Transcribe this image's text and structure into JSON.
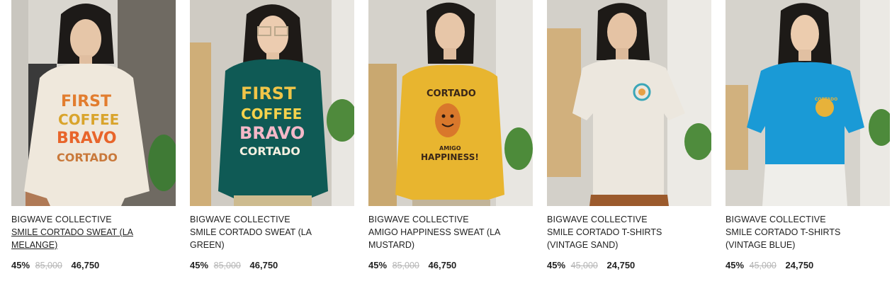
{
  "products": [
    {
      "brand": "BIGWAVE COLLECTIVE",
      "name": "SMILE CORTADO SWEAT (LA MELANGE)",
      "discount": "45%",
      "original_price": "85,000",
      "sale_price": "46,750",
      "garment_color": "#efe8dc",
      "garment_type": "sweat",
      "print_lines": [
        "FIRST",
        "COFFEE",
        "BRAVO",
        "CORTADO"
      ]
    },
    {
      "brand": "BIGWAVE COLLECTIVE",
      "name": "SMILE CORTADO SWEAT (LA GREEN)",
      "discount": "45%",
      "original_price": "85,000",
      "sale_price": "46,750",
      "garment_color": "#0f5a55",
      "garment_type": "sweat",
      "print_lines": [
        "FIRST",
        "COFFEE",
        "BRAVO",
        "CORTADO"
      ]
    },
    {
      "brand": "BIGWAVE COLLECTIVE",
      "name": "AMIGO HAPPINESS SWEAT (LA MUSTARD)",
      "discount": "45%",
      "original_price": "85,000",
      "sale_price": "46,750",
      "garment_color": "#e8b52f",
      "garment_type": "sweat",
      "print_lines": [
        "CORTADO",
        "AMIGO",
        "HAPPINESS!"
      ]
    },
    {
      "brand": "BIGWAVE COLLECTIVE",
      "name": "SMILE CORTADO T-SHIRTS (VINTAGE SAND)",
      "discount": "45%",
      "original_price": "45,000",
      "sale_price": "24,750",
      "garment_color": "#ece7de",
      "garment_type": "tee",
      "print_lines": []
    },
    {
      "brand": "BIGWAVE COLLECTIVE",
      "name": "SMILE CORTADO T-SHIRTS (VINTAGE BLUE)",
      "discount": "45%",
      "original_price": "45,000",
      "sale_price": "24,750",
      "garment_color": "#1a9ad6",
      "garment_type": "tee",
      "print_lines": []
    }
  ]
}
